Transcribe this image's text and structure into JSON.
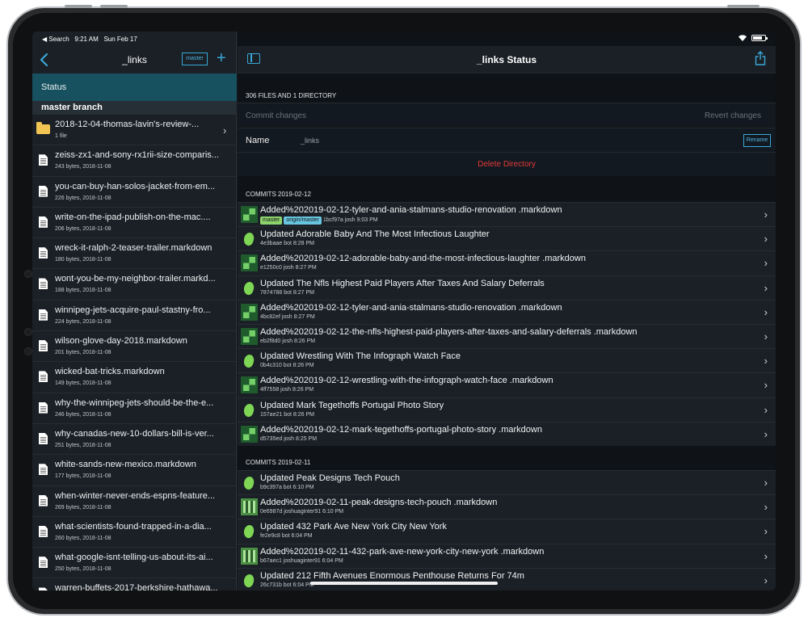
{
  "statusbar": {
    "back_app": "◀ Search",
    "time": "9:21 AM",
    "date": "Sun Feb 17"
  },
  "sidebar": {
    "title": "_links",
    "branch_button": "master",
    "add_icon": "plus-icon",
    "status_label": "Status",
    "section_label": "master branch",
    "files": [
      {
        "type": "folder",
        "name": "2018-12-04-thomas-lavin's-review-...",
        "meta": "1 file"
      },
      {
        "type": "file",
        "name": "zeiss-zx1-and-sony-rx1rii-size-comparis...",
        "meta": "243 bytes, 2018-11-08"
      },
      {
        "type": "file",
        "name": "you-can-buy-han-solos-jacket-from-em...",
        "meta": "226 bytes, 2018-11-08"
      },
      {
        "type": "file",
        "name": "write-on-the-ipad-publish-on-the-mac....",
        "meta": "206 bytes, 2018-11-08"
      },
      {
        "type": "file",
        "name": "wreck-it-ralph-2-teaser-trailer.markdown",
        "meta": "180 bytes, 2018-11-08"
      },
      {
        "type": "file",
        "name": "wont-you-be-my-neighbor-trailer.markd...",
        "meta": "188 bytes, 2018-11-08"
      },
      {
        "type": "file",
        "name": "winnipeg-jets-acquire-paul-stastny-fro...",
        "meta": "224 bytes, 2018-11-08"
      },
      {
        "type": "file",
        "name": "wilson-glove-day-2018.markdown",
        "meta": "201 bytes, 2018-11-08"
      },
      {
        "type": "file",
        "name": "wicked-bat-tricks.markdown",
        "meta": "149 bytes, 2018-11-08"
      },
      {
        "type": "file",
        "name": "why-the-winnipeg-jets-should-be-the-e...",
        "meta": "246 bytes, 2018-11-08"
      },
      {
        "type": "file",
        "name": "why-canadas-new-10-dollars-bill-is-ver...",
        "meta": "251 bytes, 2018-11-08"
      },
      {
        "type": "file",
        "name": "white-sands-new-mexico.markdown",
        "meta": "177 bytes, 2018-11-08"
      },
      {
        "type": "file",
        "name": "when-winter-never-ends-espns-feature...",
        "meta": "269 bytes, 2018-11-08"
      },
      {
        "type": "file",
        "name": "what-scientists-found-trapped-in-a-dia...",
        "meta": "260 bytes, 2018-11-08"
      },
      {
        "type": "file",
        "name": "what-google-isnt-telling-us-about-its-ai...",
        "meta": "250 bytes, 2018-11-08"
      },
      {
        "type": "file",
        "name": "warren-buffets-2017-berkshire-hathawa...",
        "meta": ""
      }
    ]
  },
  "main": {
    "title": "_links Status",
    "summary": "306 FILES AND 1 DIRECTORY",
    "commit_placeholder": "Commit changes",
    "revert_label": "Revert changes",
    "name_label": "Name",
    "name_value": "_links",
    "rename_label": "Rename",
    "delete_label": "Delete Directory",
    "groups": [
      {
        "header": "COMMITS 2019-02-12",
        "commits": [
          {
            "avatar": "josh",
            "message": "Added%202019-02-12-tyler-and-ania-stalmans-studio-renovation .markdown",
            "tags": [
              "master",
              "origin/master"
            ],
            "meta": "1bcf97a josh 9:03 PM"
          },
          {
            "avatar": "bot",
            "message": "Updated Adorable Baby And The Most Infectious Laughter",
            "tags": [],
            "meta": "4e3baae bot 8:28 PM"
          },
          {
            "avatar": "josh",
            "message": "Added%202019-02-12-adorable-baby-and-the-most-infectious-laughter .markdown",
            "tags": [],
            "meta": "e1250c0 josh 8:27 PM"
          },
          {
            "avatar": "bot",
            "message": "Updated The Nfls Highest Paid Players After Taxes And Salary Deferrals",
            "tags": [],
            "meta": "7874788 bot 8:27 PM"
          },
          {
            "avatar": "josh",
            "message": "Added%202019-02-12-tyler-and-ania-stalmans-studio-renovation .markdown",
            "tags": [],
            "meta": "4bc82ef josh 8:27 PM"
          },
          {
            "avatar": "josh",
            "message": "Added%202019-02-12-the-nfls-highest-paid-players-after-taxes-and-salary-deferrals .markdown",
            "tags": [],
            "meta": "eb2f8d0 josh 8:26 PM"
          },
          {
            "avatar": "bot",
            "message": "Updated Wrestling With The Infograph Watch Face",
            "tags": [],
            "meta": "0b4c310 bot 8:26 PM"
          },
          {
            "avatar": "josh",
            "message": "Added%202019-02-12-wrestling-with-the-infograph-watch-face .markdown",
            "tags": [],
            "meta": "4ff7558 josh 8:26 PM"
          },
          {
            "avatar": "bot",
            "message": "Updated Mark Tegethoffs Portugal Photo Story",
            "tags": [],
            "meta": "157ae21 bot 8:26 PM"
          },
          {
            "avatar": "josh",
            "message": "Added%202019-02-12-mark-tegethoffs-portugal-photo-story .markdown",
            "tags": [],
            "meta": "d5735ed josh 8:25 PM"
          }
        ]
      },
      {
        "header": "COMMITS 2019-02-11",
        "commits": [
          {
            "avatar": "bot",
            "message": "Updated Peak Designs Tech Pouch",
            "tags": [],
            "meta": "b9c397a bot 6:10 PM"
          },
          {
            "avatar": "jg",
            "message": "Added%202019-02-11-peak-designs-tech-pouch .markdown",
            "tags": [],
            "meta": "0e6987d joshuaginter91 6:10 PM"
          },
          {
            "avatar": "bot",
            "message": "Updated 432 Park Ave New York City New York",
            "tags": [],
            "meta": "fe2e9c8 bot 6:04 PM"
          },
          {
            "avatar": "jg",
            "message": "Added%202019-02-11-432-park-ave-new-york-city-new-york .markdown",
            "tags": [],
            "meta": "b67aec1 joshuaginter91 6:04 PM"
          },
          {
            "avatar": "bot",
            "message": "Updated 212 Fifth Avenues Enormous Penthouse Returns For 74m",
            "tags": [],
            "meta": "26c731b bot 6:04 PM"
          }
        ]
      }
    ]
  }
}
